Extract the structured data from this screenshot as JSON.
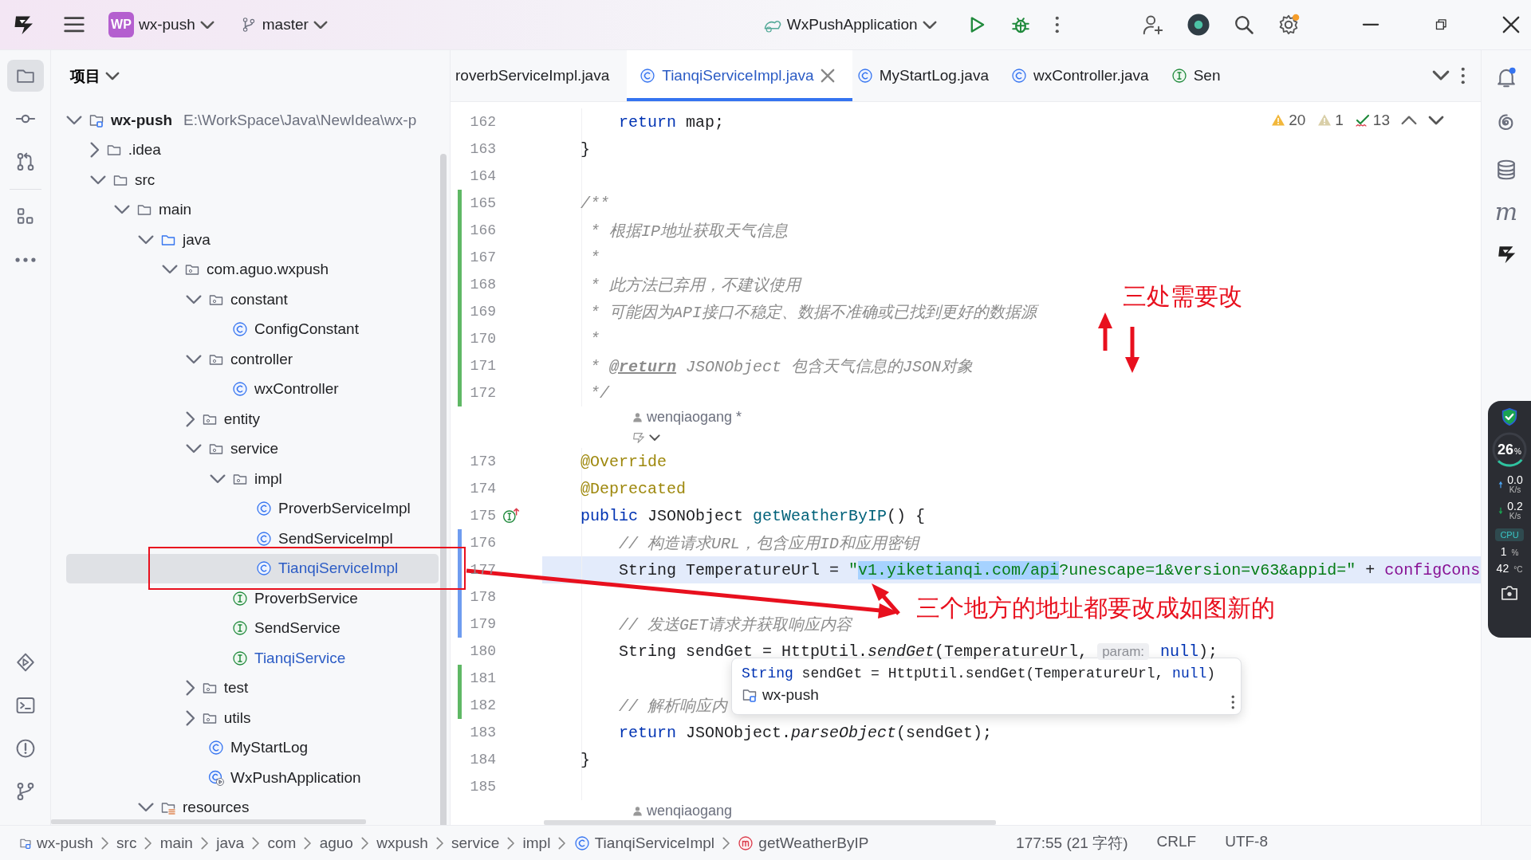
{
  "title_bar": {
    "project_badge": "WP",
    "project": "wx-push",
    "branch": "master",
    "run_config": "WxPushApplication"
  },
  "left_toolbar": [
    {
      "kind": "folder",
      "selected": true
    },
    {
      "kind": "commit",
      "selected": false
    },
    {
      "kind": "pull-request",
      "selected": false
    },
    {
      "kind": "structure",
      "selected": false
    },
    {
      "kind": "more",
      "selected": false
    }
  ],
  "left_toolbar_bottom": [
    {
      "kind": "run"
    },
    {
      "kind": "terminal"
    },
    {
      "kind": "problems"
    },
    {
      "kind": "git"
    }
  ],
  "project_panel": {
    "title": "项目",
    "tree": [
      {
        "label": "wx-push",
        "kind": "module",
        "path": "E:\\WorkSpace\\Java\\NewIdea\\wx-p",
        "expanded": true,
        "selected": false,
        "children": [
          {
            "label": ".idea",
            "kind": "folder",
            "expanded": false,
            "selected": false
          },
          {
            "label": "src",
            "kind": "folder",
            "expanded": true,
            "selected": false,
            "children": [
              {
                "label": "main",
                "kind": "folder",
                "expanded": true,
                "selected": false,
                "children": [
                  {
                    "label": "java",
                    "kind": "source",
                    "expanded": true,
                    "selected": false,
                    "children": [
                      {
                        "label": "com.aguo.wxpush",
                        "kind": "package",
                        "expanded": true,
                        "selected": false,
                        "children": [
                          {
                            "label": "constant",
                            "kind": "package",
                            "expanded": true,
                            "selected": false,
                            "children": [
                              {
                                "label": "ConfigConstant",
                                "kind": "class",
                                "selected": false,
                                "modified": false
                              }
                            ]
                          },
                          {
                            "label": "controller",
                            "kind": "package",
                            "expanded": true,
                            "selected": false,
                            "children": [
                              {
                                "label": "wxController",
                                "kind": "class",
                                "selected": false,
                                "modified": false
                              }
                            ]
                          },
                          {
                            "label": "entity",
                            "kind": "package",
                            "expanded": false,
                            "selected": false
                          },
                          {
                            "label": "service",
                            "kind": "package",
                            "expanded": true,
                            "selected": false,
                            "children": [
                              {
                                "label": "impl",
                                "kind": "package",
                                "expanded": true,
                                "selected": false,
                                "children": [
                                  {
                                    "label": "ProverbServiceImpl",
                                    "kind": "class",
                                    "selected": false,
                                    "modified": false
                                  },
                                  {
                                    "label": "SendServiceImpl",
                                    "kind": "class",
                                    "selected": false,
                                    "modified": false
                                  },
                                  {
                                    "label": "TianqiServiceImpl",
                                    "kind": "class",
                                    "selected": true,
                                    "modified": true
                                  }
                                ]
                              },
                              {
                                "label": "ProverbService",
                                "kind": "interface",
                                "selected": false,
                                "modified": false
                              },
                              {
                                "label": "SendService",
                                "kind": "interface",
                                "selected": false,
                                "modified": false
                              },
                              {
                                "label": "TianqiService",
                                "kind": "interface",
                                "selected": false,
                                "modified": true
                              }
                            ]
                          },
                          {
                            "label": "test",
                            "kind": "package",
                            "expanded": false,
                            "selected": false
                          },
                          {
                            "label": "utils",
                            "kind": "package",
                            "expanded": false,
                            "selected": false
                          },
                          {
                            "label": "MyStartLog",
                            "kind": "class",
                            "selected": false,
                            "modified": false
                          },
                          {
                            "label": "WxPushApplication",
                            "kind": "app",
                            "selected": false,
                            "modified": false
                          }
                        ]
                      }
                    ]
                  },
                  {
                    "label": "resources",
                    "kind": "resources",
                    "expanded": true,
                    "selected": false
                  }
                ]
              }
            ]
          }
        ]
      }
    ]
  },
  "tabs": [
    {
      "label": "roverbServiceImpl.java",
      "kind": "cut",
      "selected": false
    },
    {
      "label": "TianqiServiceImpl.java",
      "kind": "class",
      "selected": true
    },
    {
      "label": "MyStartLog.java",
      "kind": "class",
      "selected": false
    },
    {
      "label": "wxController.java",
      "kind": "class",
      "selected": false
    },
    {
      "label": "Sen",
      "kind": "interface",
      "selected": false
    }
  ],
  "inspections": [
    {
      "kind": "warning",
      "count": "20"
    },
    {
      "kind": "weak-warning",
      "count": "1"
    },
    {
      "kind": "typo",
      "count": "13"
    }
  ],
  "code": [
    {
      "kind": "code",
      "number": "162",
      "current": false,
      "segments": [
        {
          "kind": "kw",
          "text": "        return"
        },
        {
          "kind": "plain",
          "text": " map;"
        }
      ]
    },
    {
      "kind": "code",
      "number": "163",
      "current": false,
      "segments": [
        {
          "kind": "plain",
          "text": "    }"
        }
      ]
    },
    {
      "kind": "code",
      "number": "164",
      "current": false
    },
    {
      "kind": "code",
      "number": "165",
      "current": false,
      "color": "#5fb865",
      "segments": [
        {
          "kind": "comment",
          "text": "    /**"
        }
      ]
    },
    {
      "kind": "code",
      "number": "166",
      "current": false,
      "color": "#5fb865",
      "segments": [
        {
          "kind": "comment",
          "text": "     * 根据IP地址获取天气信息"
        }
      ]
    },
    {
      "kind": "code",
      "number": "167",
      "current": false,
      "color": "#5fb865",
      "segments": [
        {
          "kind": "comment",
          "text": "     *"
        }
      ]
    },
    {
      "kind": "code",
      "number": "168",
      "current": false,
      "color": "#5fb865",
      "segments": [
        {
          "kind": "comment",
          "text": "     * 此方法已弃用，不建议使用"
        }
      ]
    },
    {
      "kind": "code",
      "number": "169",
      "current": false,
      "color": "#5fb865",
      "segments": [
        {
          "kind": "comment",
          "text": "     * 可能因为API接口不稳定、数据不准确或已找到更好的数据源"
        }
      ]
    },
    {
      "kind": "code",
      "number": "170",
      "current": false,
      "color": "#5fb865",
      "segments": [
        {
          "kind": "comment",
          "text": "     *"
        }
      ]
    },
    {
      "kind": "code",
      "number": "171",
      "current": false,
      "color": "#5fb865",
      "segments": [
        {
          "kind": "comment",
          "text": "     * "
        },
        {
          "kind": "doctag",
          "text": "@return"
        },
        {
          "kind": "comment",
          "text": " JSONObject 包含天气信息的JSON对象"
        }
      ]
    },
    {
      "kind": "code",
      "number": "172",
      "current": false,
      "color": "#5fb865",
      "segments": [
        {
          "kind": "comment",
          "text": "     */"
        }
      ]
    },
    {
      "kind": "author",
      "text": "wenqiaogang *"
    },
    {
      "kind": "ai"
    },
    {
      "kind": "code",
      "number": "173",
      "current": false,
      "segments": [
        {
          "kind": "anno",
          "text": "    @Override"
        }
      ]
    },
    {
      "kind": "code",
      "number": "174",
      "current": false,
      "segments": [
        {
          "kind": "anno",
          "text": "    @Deprecated"
        }
      ]
    },
    {
      "kind": "code",
      "number": "175",
      "current": false,
      "implements_marker": true,
      "segments": [
        {
          "kind": "kw",
          "text": "    public"
        },
        {
          "kind": "plain",
          "text": " JSONObject "
        },
        {
          "kind": "method",
          "text": "getWeatherByIP"
        },
        {
          "kind": "plain",
          "text": "() {"
        }
      ]
    },
    {
      "kind": "code",
      "number": "176",
      "current": false,
      "color": "#6f9cf0",
      "segments": [
        {
          "kind": "comment",
          "text": "        // 构造请求URL，包含应用ID和应用密钥"
        }
      ]
    },
    {
      "kind": "code",
      "number": "177",
      "current": true,
      "color": "#6f9cf0",
      "segments": [
        {
          "kind": "plain",
          "text": "        String TemperatureUrl = "
        },
        {
          "kind": "string",
          "text": "\""
        },
        {
          "kind": "string-selected",
          "text": "v1.yiketianqi.com/api"
        },
        {
          "kind": "string",
          "text": "?unescape=1&version=v63&appid=\""
        },
        {
          "kind": "plain",
          "text": " + "
        },
        {
          "kind": "field",
          "text": "configCons"
        }
      ]
    },
    {
      "kind": "code",
      "number": "178",
      "current": false,
      "color": "#6f9cf0"
    },
    {
      "kind": "code",
      "number": "179",
      "current": false,
      "color": "#6f9cf0",
      "segments": [
        {
          "kind": "comment",
          "text": "        // 发送GET请求并获取响应内容"
        }
      ]
    },
    {
      "kind": "code",
      "number": "180",
      "current": false,
      "segments": [
        {
          "kind": "plain",
          "text": "        String sendGet = HttpUtil."
        },
        {
          "kind": "static",
          "text": "sendGet"
        },
        {
          "kind": "plain",
          "text": "(TemperatureUrl, "
        },
        {
          "kind": "hint",
          "text": "param:"
        },
        {
          "kind": "kw",
          "text": " null"
        },
        {
          "kind": "plain",
          "text": ");"
        }
      ]
    },
    {
      "kind": "code",
      "number": "181",
      "current": false,
      "color": "#5fb865"
    },
    {
      "kind": "code",
      "number": "182",
      "current": false,
      "color": "#5fb865",
      "segments": [
        {
          "kind": "comment",
          "text": "        // 解析响应内"
        }
      ]
    },
    {
      "kind": "code",
      "number": "183",
      "current": false,
      "segments": [
        {
          "kind": "kw",
          "text": "        return"
        },
        {
          "kind": "plain",
          "text": " JSONObject."
        },
        {
          "kind": "static",
          "text": "parseObject"
        },
        {
          "kind": "plain",
          "text": "(sendGet);"
        }
      ]
    },
    {
      "kind": "code",
      "number": "184",
      "current": false,
      "segments": [
        {
          "kind": "plain",
          "text": "    }"
        }
      ]
    },
    {
      "kind": "code",
      "number": "185",
      "current": false
    },
    {
      "kind": "author",
      "text": "wenqiaogang"
    }
  ],
  "tooltip": {
    "segments": [
      {
        "kind": "kw",
        "text": "String"
      },
      {
        "kind": "plain",
        "text": " sendGet = HttpUtil.sendGet(TemperatureUrl, "
      },
      {
        "kind": "kw",
        "text": "null"
      },
      {
        "kind": "plain",
        "text": ")"
      }
    ],
    "module": "wx-push"
  },
  "right_toolbar": [
    {
      "kind": "bell"
    },
    {
      "kind": "spiral"
    },
    {
      "kind": "database"
    },
    {
      "kind": "glyph",
      "glyph": "m"
    },
    {
      "kind": "logo"
    }
  ],
  "monitor": {
    "cpu_percent": "26",
    "percent_sign": "%",
    "level": 0.26,
    "upload": "0.0",
    "upload_unit": "K/s",
    "download": "0.2",
    "download_unit": "K/s",
    "cpu_label": "CPU",
    "cpu_load": "1",
    "cpu_load_unit": "%",
    "temperature": "42",
    "temperature_unit": "°C"
  },
  "breadcrumbs": [
    {
      "label": "wx-push",
      "kind": "module"
    },
    {
      "label": "src",
      "kind": "path"
    },
    {
      "label": "main",
      "kind": "path"
    },
    {
      "label": "java",
      "kind": "path"
    },
    {
      "label": "com",
      "kind": "path"
    },
    {
      "label": "aguo",
      "kind": "path"
    },
    {
      "label": "wxpush",
      "kind": "path"
    },
    {
      "label": "service",
      "kind": "path"
    },
    {
      "label": "impl",
      "kind": "path"
    },
    {
      "label": "TianqiServiceImpl",
      "kind": "class"
    },
    {
      "label": "getWeatherByIP",
      "kind": "method"
    }
  ],
  "status_items": [
    "177:55 (21 字符)",
    "CRLF",
    "UTF-8"
  ],
  "annotations": [
    {
      "text": "三处需要改"
    },
    {
      "text": "三个地方的地址都要改成如图新的"
    }
  ]
}
